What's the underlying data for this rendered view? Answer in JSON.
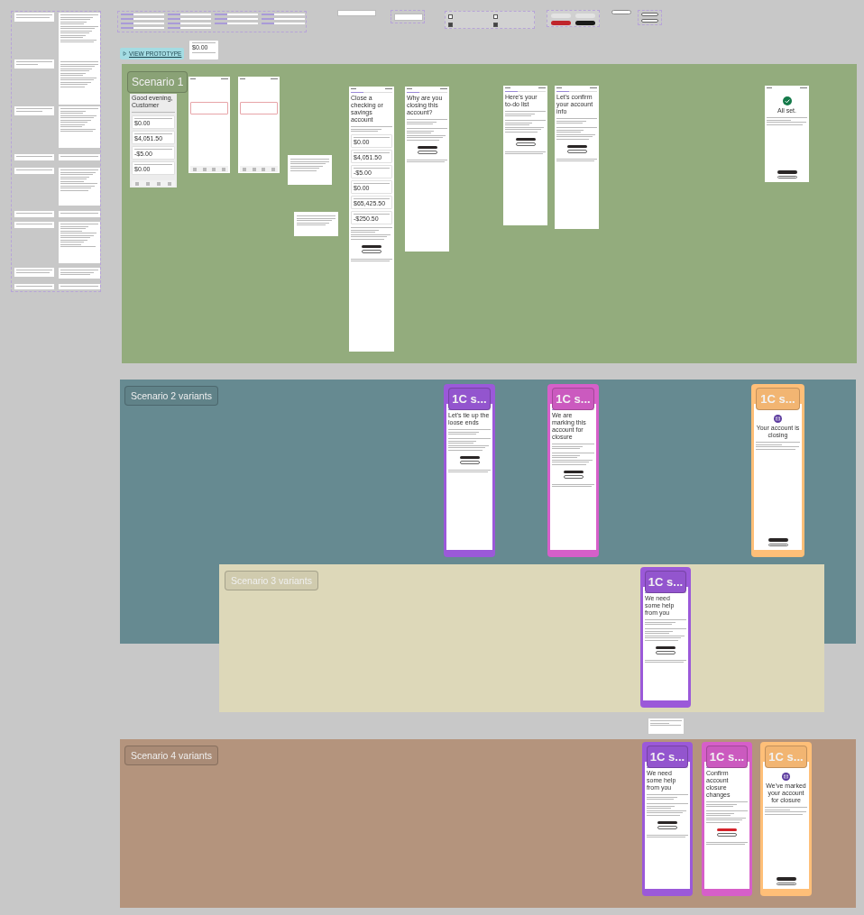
{
  "prototype_button": "VIEW PROTOTYPE",
  "component_card": {
    "amount": "$0.00"
  },
  "sections": [
    {
      "title": "Scenario 1",
      "color": "#93ac7d",
      "screens": [
        {
          "kind": "home",
          "headline": "Good evening, Customer",
          "amounts": [
            "$0.00",
            "$4,051.50",
            "-$5.00",
            "$0.00"
          ]
        },
        {
          "kind": "blank"
        },
        {
          "kind": "blank"
        },
        {
          "kind": "dialog"
        },
        {
          "kind": "dialog"
        },
        {
          "kind": "form",
          "headline": "Close a checking or savings account",
          "amounts": [
            "$0.00",
            "$4,051.50",
            "-$5.00",
            "$0.00",
            "$65,425.50",
            "-$250.50"
          ]
        },
        {
          "kind": "form",
          "headline": "Why are you closing this account?"
        },
        {
          "kind": "form",
          "headline": "Here's your to-do list"
        },
        {
          "kind": "form",
          "headline": "Let's confirm your account info"
        },
        {
          "kind": "success",
          "headline": "All set."
        }
      ]
    },
    {
      "title": "Scenario 2 variants",
      "color": "#668a91",
      "variants": [
        {
          "label": "1C s...",
          "color": "#9b59d9",
          "screen": {
            "kind": "form",
            "headline": "Let's tie up the loose ends"
          }
        },
        {
          "label": "1C s...",
          "color": "#d65fc9",
          "screen": {
            "kind": "form",
            "headline": "We are marking this account for closure"
          }
        },
        {
          "label": "1C s...",
          "color": "#ffbf78",
          "screen": {
            "kind": "closing",
            "headline": "Your account is closing"
          }
        }
      ]
    },
    {
      "title": "Scenario 3 variants",
      "color": "#ddd8b9",
      "variants": [
        {
          "label": "1C s...",
          "color": "#9b59d9",
          "screen": {
            "kind": "form",
            "headline": "We need some help from you"
          }
        }
      ]
    },
    {
      "title": "Scenario 4 variants",
      "color": "#b4947d",
      "variants": [
        {
          "label": "1C s...",
          "color": "#9b59d9",
          "screen": {
            "kind": "form",
            "headline": "We need some help from you"
          }
        },
        {
          "label": "1C s...",
          "color": "#d65fc9",
          "screen": {
            "kind": "form",
            "headline": "Confirm account closure changes",
            "danger": true
          }
        },
        {
          "label": "1C s...",
          "color": "#ffbf78",
          "screen": {
            "kind": "closing",
            "headline": "We've marked your account for closure"
          }
        }
      ]
    }
  ]
}
